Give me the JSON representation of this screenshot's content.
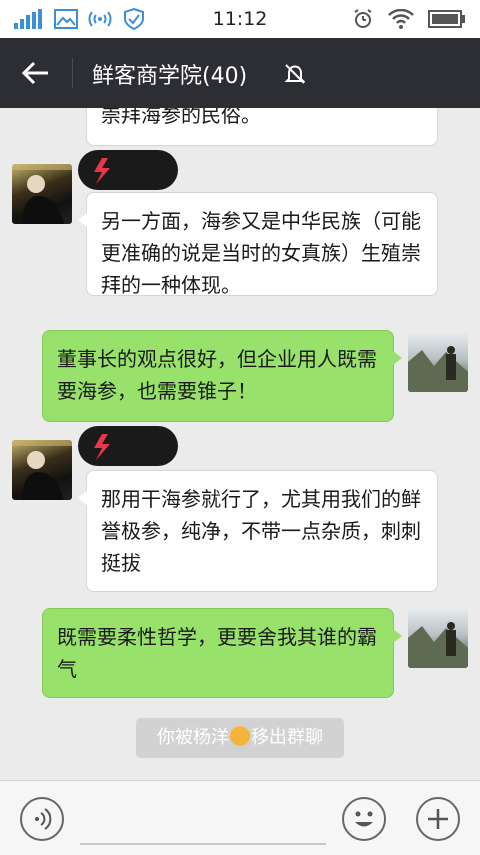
{
  "status_bar": {
    "time": "11:12",
    "icons": [
      "signal-icon",
      "image-icon",
      "wifi-hotspot-icon",
      "shield-check-icon",
      "alarm-icon",
      "wifi-icon",
      "battery-icon"
    ]
  },
  "header": {
    "back_icon": "back-arrow-icon",
    "title": "鲜客商学院(40)",
    "mute_icon": "bell-muted-icon"
  },
  "messages": [
    {
      "direction": "in",
      "text": "崇拜海参的民俗。"
    },
    {
      "direction": "in",
      "avatar": "avatar-man",
      "text": "另一方面，海参又是中华民族（可能更准确的说是当时的女真族）生殖崇拜的一种体现。"
    },
    {
      "direction": "out",
      "avatar": "avatar-mountain",
      "text": "董事长的观点很好，但企业用人既需要海参，也需要锥子！"
    },
    {
      "direction": "in",
      "avatar": "avatar-man",
      "text": "那用干海参就行了，尤其用我们的鲜誉极参，纯净，不带一点杂质，刺刺挺拔"
    },
    {
      "direction": "out",
      "avatar": "avatar-mountain",
      "text": "既需要柔性哲学，更要舍我其谁的霸气"
    }
  ],
  "system_notice": {
    "before": "你被杨洋",
    "after": "移出群聊"
  },
  "input_bar": {
    "voice_icon": "voice-icon",
    "emoji_icon": "emoji-icon",
    "plus_icon": "plus-icon"
  },
  "colors": {
    "header_bg": "#2d2e33",
    "chat_bg": "#ebebeb",
    "bubble_out": "#98e16a",
    "bubble_in": "#ffffff"
  }
}
